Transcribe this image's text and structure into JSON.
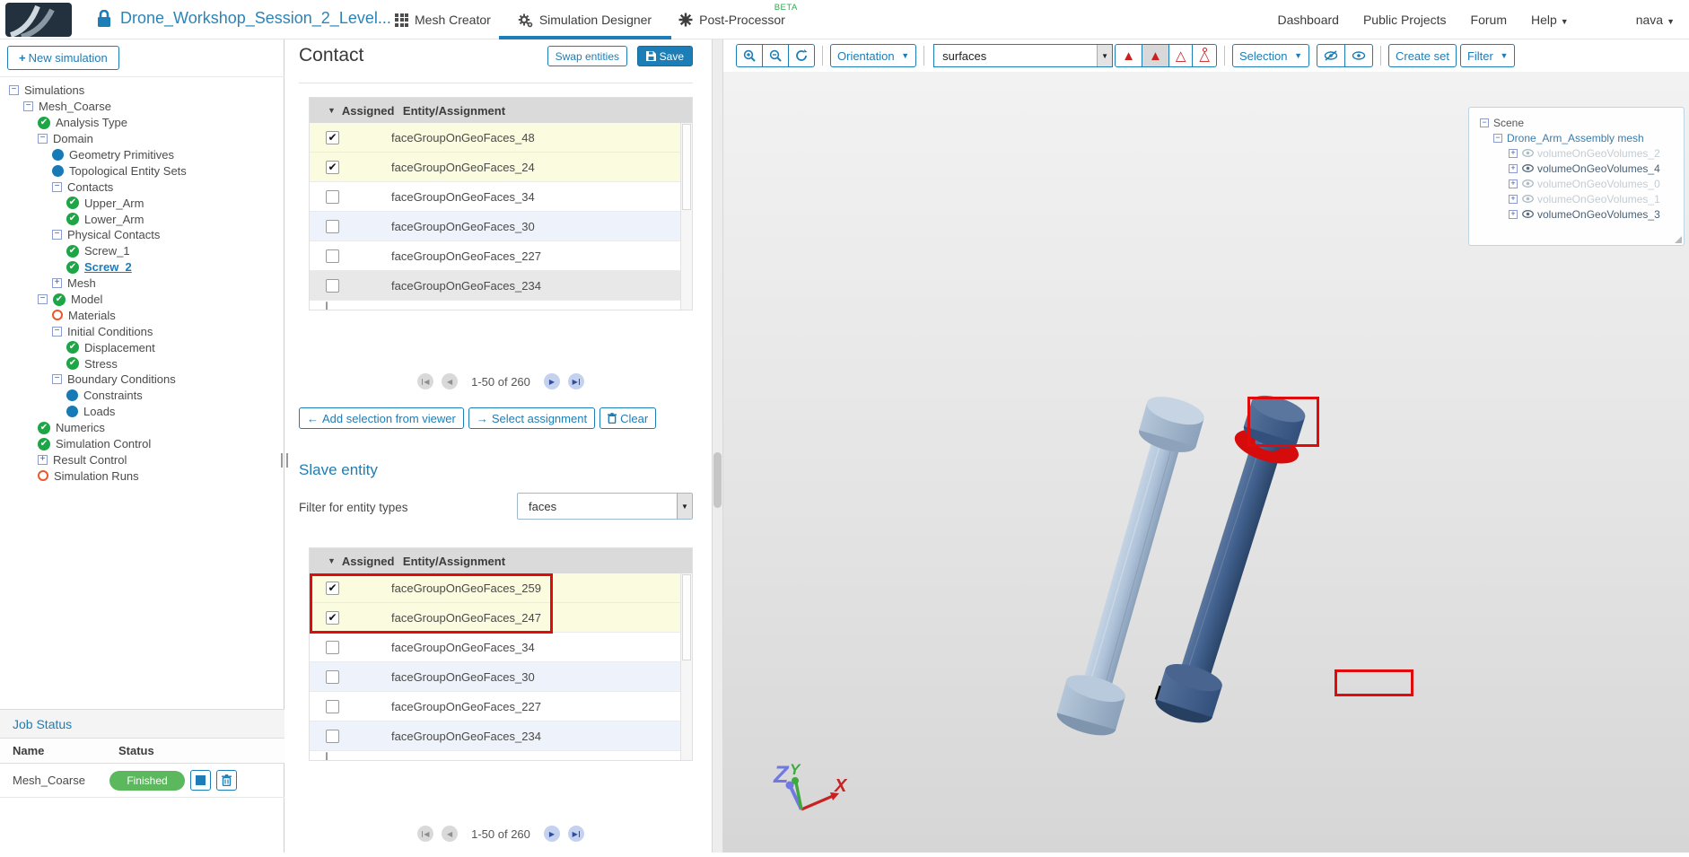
{
  "colors": {
    "accent": "#1d7db6",
    "finished_green": "#5cb85c",
    "highlight_red": "#e00c0c",
    "bolt_light": "#a9bdd6",
    "bolt_dark": "#3f5e8c"
  },
  "top_bar": {
    "title": "Drone_Workshop_Session_2_Level...",
    "tab_mesh_creator": "Mesh Creator",
    "tab_simulation_designer": "Simulation Designer",
    "tab_post_processor": "Post-Processor",
    "beta_badge": "BETA",
    "link_dashboard": "Dashboard",
    "link_public_projects": "Public Projects",
    "link_forum": "Forum",
    "link_help": "Help",
    "user": "nava"
  },
  "sidebar": {
    "new_simulation": "New simulation",
    "tree": [
      {
        "label": "Simulations",
        "level": 0,
        "expander": "minus"
      },
      {
        "label": "Mesh_Coarse",
        "level": 1,
        "expander": "minus"
      },
      {
        "label": "Analysis Type",
        "level": 2,
        "icon": "check"
      },
      {
        "label": "Domain",
        "level": 2,
        "expander": "minus"
      },
      {
        "label": "Geometry Primitives",
        "level": 3,
        "icon": "dot"
      },
      {
        "label": "Topological Entity Sets",
        "level": 3,
        "icon": "dot"
      },
      {
        "label": "Contacts",
        "level": 3,
        "expander": "minus"
      },
      {
        "label": "Upper_Arm",
        "level": 4,
        "icon": "check"
      },
      {
        "label": "Lower_Arm",
        "level": 4,
        "icon": "check"
      },
      {
        "label": "Physical Contacts",
        "level": 3,
        "expander": "minus"
      },
      {
        "label": "Screw_1",
        "level": 4,
        "icon": "check"
      },
      {
        "label": "Screw_2",
        "level": 4,
        "icon": "check",
        "selected": true
      },
      {
        "label": "Mesh",
        "level": 3,
        "expander": "plus"
      },
      {
        "label": "Model",
        "level": 2,
        "expander": "minus",
        "icon": "check"
      },
      {
        "label": "Materials",
        "level": 3,
        "icon": "ring"
      },
      {
        "label": "Initial Conditions",
        "level": 3,
        "expander": "minus"
      },
      {
        "label": "Displacement",
        "level": 4,
        "icon": "check"
      },
      {
        "label": "Stress",
        "level": 4,
        "icon": "check"
      },
      {
        "label": "Boundary Conditions",
        "level": 3,
        "expander": "minus"
      },
      {
        "label": "Constraints",
        "level": 4,
        "icon": "dot"
      },
      {
        "label": "Loads",
        "level": 4,
        "icon": "dot"
      },
      {
        "label": "Numerics",
        "level": 2,
        "icon": "check"
      },
      {
        "label": "Simulation Control",
        "level": 2,
        "icon": "check"
      },
      {
        "label": "Result Control",
        "level": 2,
        "expander": "plus"
      },
      {
        "label": "Simulation Runs",
        "level": 2,
        "icon": "ring"
      }
    ],
    "job_status": {
      "title": "Job Status",
      "col_name": "Name",
      "col_status": "Status",
      "job_name": "Mesh_Coarse",
      "job_state": "Finished"
    }
  },
  "panel": {
    "title": "Contact",
    "swap_button": "Swap entities",
    "save_button": "Save",
    "assigned_header": "Assigned",
    "entity_header": "Entity/Assignment",
    "master_rows": [
      {
        "name": "faceGroupOnGeoFaces_48",
        "checked": true,
        "variant": "yellow"
      },
      {
        "name": "faceGroupOnGeoFaces_24",
        "checked": true,
        "variant": "yellow"
      },
      {
        "name": "faceGroupOnGeoFaces_34",
        "checked": false,
        "variant": "white"
      },
      {
        "name": "faceGroupOnGeoFaces_30",
        "checked": false,
        "variant": "blue"
      },
      {
        "name": "faceGroupOnGeoFaces_227",
        "checked": false,
        "variant": "white"
      },
      {
        "name": "faceGroupOnGeoFaces_234",
        "checked": false,
        "variant": "gray"
      }
    ],
    "master_pagination": "1-50 of 260",
    "add_selection_button": "Add selection from viewer",
    "select_assignment_button": "Select assignment",
    "clear_button": "Clear",
    "slave_heading": "Slave entity",
    "filter_label": "Filter for entity types",
    "filter_value": "faces",
    "slave_rows": [
      {
        "name": "faceGroupOnGeoFaces_259",
        "checked": true,
        "variant": "yellow"
      },
      {
        "name": "faceGroupOnGeoFaces_247",
        "checked": true,
        "variant": "yellow"
      },
      {
        "name": "faceGroupOnGeoFaces_34",
        "checked": false,
        "variant": "white"
      },
      {
        "name": "faceGroupOnGeoFaces_30",
        "checked": false,
        "variant": "blue"
      },
      {
        "name": "faceGroupOnGeoFaces_227",
        "checked": false,
        "variant": "white"
      },
      {
        "name": "faceGroupOnGeoFaces_234",
        "checked": false,
        "variant": "blue"
      }
    ],
    "slave_pagination": "1-50 of 260"
  },
  "viewer": {
    "toolbar": {
      "orientation": "Orientation",
      "surface_filter": "surfaces",
      "selection": "Selection",
      "create_set": "Create set",
      "filter": "Filter"
    },
    "scene_tree": {
      "root": "Scene",
      "mesh": "Drone_Arm_Assembly mesh",
      "volumes": [
        {
          "name": "volumeOnGeoVolumes_2",
          "dimmed": true
        },
        {
          "name": "volumeOnGeoVolumes_4",
          "dimmed": false
        },
        {
          "name": "volumeOnGeoVolumes_0",
          "dimmed": true
        },
        {
          "name": "volumeOnGeoVolumes_1",
          "dimmed": true
        },
        {
          "name": "volumeOnGeoVolumes_3",
          "dimmed": false
        }
      ]
    },
    "axes": {
      "x": "X",
      "y": "Y",
      "z": "Z"
    }
  }
}
